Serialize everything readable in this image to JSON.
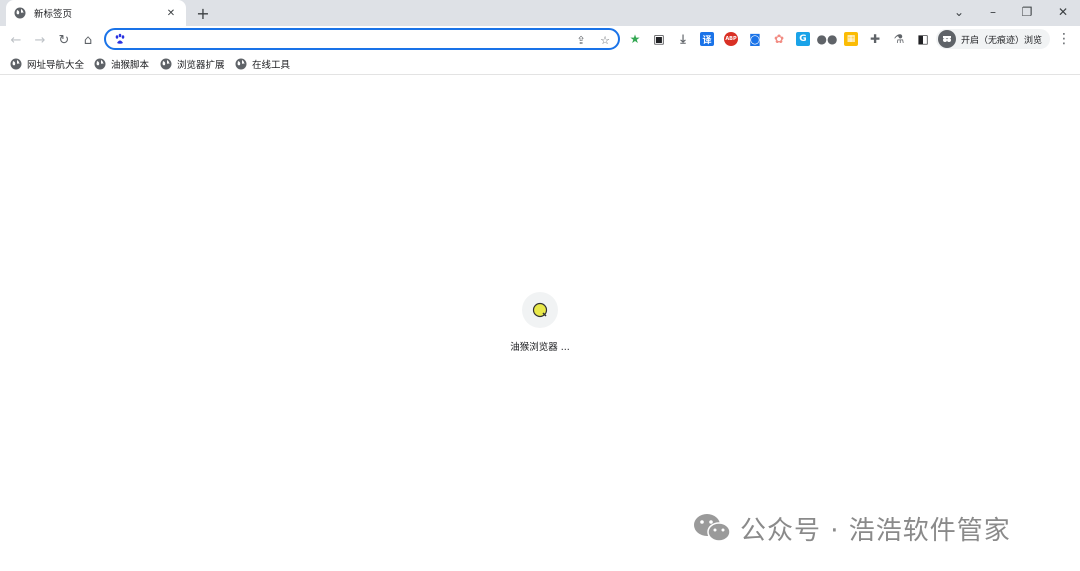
{
  "tab": {
    "title": "新标签页",
    "close_icon": "close-icon"
  },
  "new_tab_glyph": "+",
  "window_controls": {
    "dropdown": "⌄",
    "minimize": "–",
    "restore": "❐",
    "close": "✕"
  },
  "toolbar": {
    "back": "←",
    "forward": "→",
    "reload": "↻",
    "home": "⌂",
    "omnibox": {
      "value": "",
      "placeholder": "",
      "engine_icon": "baidu-paw-icon"
    }
  },
  "extensions": [
    {
      "name": "star-green-icon",
      "color": "#34a853",
      "glyph": "★"
    },
    {
      "name": "qr-scan-icon",
      "color": "#202124",
      "glyph": "▣"
    },
    {
      "name": "download-icon",
      "color": "#5f6368",
      "glyph": "⤓"
    },
    {
      "name": "translate-icon",
      "color": "#1a73e8",
      "glyph": "译"
    },
    {
      "name": "adblock-icon",
      "color": "#d93025",
      "glyph": "ABP"
    },
    {
      "name": "screenshot-icon",
      "color": "#1a73e8",
      "glyph": "◙"
    },
    {
      "name": "flower-icon",
      "color": "#f28b82",
      "glyph": "✿"
    },
    {
      "name": "cloud-icon",
      "color": "#1aa3e8",
      "glyph": "G"
    },
    {
      "name": "tampermonkey-icon",
      "color": "#5f6368",
      "glyph": "●●"
    },
    {
      "name": "color-picker-icon",
      "color": "#fbbc04",
      "glyph": "▦"
    },
    {
      "name": "puzzle-icon",
      "color": "#5f6368",
      "glyph": "✚"
    },
    {
      "name": "flask-icon",
      "color": "#5f6368",
      "glyph": "⚗"
    },
    {
      "name": "side-panel-icon",
      "color": "#202124",
      "glyph": "◧"
    }
  ],
  "profile": {
    "label": "开启（无痕迹）浏览"
  },
  "menu_glyph": "⋮",
  "bookmarks": [
    {
      "label": "网址导航大全"
    },
    {
      "label": "油猴脚本"
    },
    {
      "label": "浏览器扩展"
    },
    {
      "label": "在线工具"
    }
  ],
  "shortcut": {
    "label": "油猴浏览器 ...",
    "color": "#e8e84a"
  },
  "watermark": {
    "text": "公众号 · 浩浩软件管家"
  }
}
